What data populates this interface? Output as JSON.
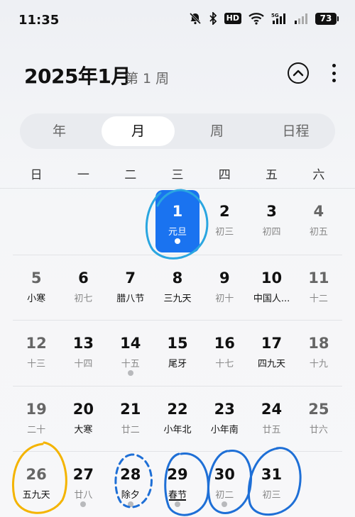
{
  "status": {
    "time": "11:35",
    "hd_label": "HD",
    "battery": "73",
    "icons": [
      "mute-bell-icon",
      "bluetooth-icon",
      "hd-icon",
      "wifi-icon",
      "signal-5g-icon",
      "signal-icon",
      "battery-icon"
    ]
  },
  "header": {
    "title": "2025年1月",
    "week": "第 1 周"
  },
  "tabs": [
    "年",
    "月",
    "周",
    "日程"
  ],
  "active_tab": "月",
  "weekdays": [
    "日",
    "一",
    "二",
    "三",
    "四",
    "五",
    "六"
  ],
  "weeks": [
    [
      {
        "num": "",
        "sub": ""
      },
      {
        "num": "",
        "sub": ""
      },
      {
        "num": "",
        "sub": ""
      },
      {
        "num": "1",
        "sub": "元旦",
        "selected": true,
        "dot": true
      },
      {
        "num": "2",
        "sub": "初三"
      },
      {
        "num": "3",
        "sub": "初四"
      },
      {
        "num": "4",
        "sub": "初五"
      }
    ],
    [
      {
        "num": "5",
        "sub": "小寒",
        "holiday": true
      },
      {
        "num": "6",
        "sub": "初七"
      },
      {
        "num": "7",
        "sub": "腊八节",
        "holiday": true
      },
      {
        "num": "8",
        "sub": "三九天",
        "holiday": true
      },
      {
        "num": "9",
        "sub": "初十"
      },
      {
        "num": "10",
        "sub": "中国人...",
        "holiday": true
      },
      {
        "num": "11",
        "sub": "十二"
      }
    ],
    [
      {
        "num": "12",
        "sub": "十三"
      },
      {
        "num": "13",
        "sub": "十四"
      },
      {
        "num": "14",
        "sub": "十五",
        "dot": true
      },
      {
        "num": "15",
        "sub": "尾牙",
        "holiday": true
      },
      {
        "num": "16",
        "sub": "十七"
      },
      {
        "num": "17",
        "sub": "四九天",
        "holiday": true
      },
      {
        "num": "18",
        "sub": "十九"
      }
    ],
    [
      {
        "num": "19",
        "sub": "二十"
      },
      {
        "num": "20",
        "sub": "大寒",
        "holiday": true
      },
      {
        "num": "21",
        "sub": "廿二"
      },
      {
        "num": "22",
        "sub": "小年北",
        "holiday": true
      },
      {
        "num": "23",
        "sub": "小年南",
        "holiday": true
      },
      {
        "num": "24",
        "sub": "廿五"
      },
      {
        "num": "25",
        "sub": "廿六"
      }
    ],
    [
      {
        "num": "26",
        "sub": "五九天",
        "holiday": true
      },
      {
        "num": "27",
        "sub": "廿八",
        "dot": true
      },
      {
        "num": "28",
        "sub": "除夕",
        "holiday": true,
        "dot": true
      },
      {
        "num": "29",
        "sub": "春节",
        "holiday": true,
        "dot": true,
        "underline": true
      },
      {
        "num": "30",
        "sub": "初二",
        "dot": true
      },
      {
        "num": "31",
        "sub": "初三"
      },
      {
        "num": "",
        "sub": ""
      }
    ]
  ],
  "colors": {
    "accent": "#1a73f0",
    "annotation_blue": "#1e6fd6",
    "annotation_cyan": "#2aa6e0",
    "annotation_yellow": "#f4b400"
  }
}
